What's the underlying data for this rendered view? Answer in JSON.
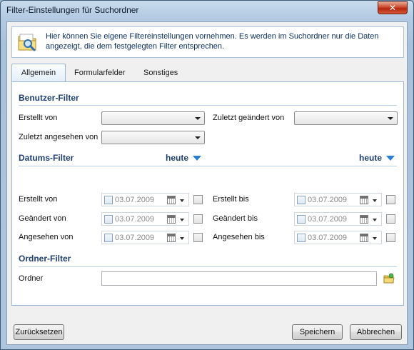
{
  "window": {
    "title": "Filter-Einstellungen für Suchordner"
  },
  "info": {
    "icon": "search-folder-icon",
    "text_line1": "Hier können Sie eigene Filtereinstellungen vornehmen. Es werden im Suchordner nur die Daten",
    "text_line2": "angezeigt, die dem festgelegten Filter entsprechen."
  },
  "tabs": [
    {
      "label": "Allgemein",
      "active": true
    },
    {
      "label": "Formularfelder",
      "active": false
    },
    {
      "label": "Sonstiges",
      "active": false
    }
  ],
  "benutzer_filter": {
    "title": "Benutzer-Filter",
    "erstellt_von": "Erstellt von",
    "zuletzt_geaendert_von": "Zuletzt geändert von",
    "zuletzt_angesehen_von": "Zuletzt angesehen von"
  },
  "datums_filter": {
    "title": "Datums-Filter",
    "heute_left": "heute",
    "heute_right": "heute",
    "rows": [
      {
        "left_label": "Erstellt von",
        "left_date": "03.07.2009",
        "right_label": "Erstellt bis",
        "right_date": "03.07.2009"
      },
      {
        "left_label": "Geändert von",
        "left_date": "03.07.2009",
        "right_label": "Geändert bis",
        "right_date": "03.07.2009"
      },
      {
        "left_label": "Angesehen von",
        "left_date": "03.07.2009",
        "right_label": "Angesehen bis",
        "right_date": "03.07.2009"
      }
    ]
  },
  "ordner_filter": {
    "title": "Ordner-Filter",
    "ordner_label": "Ordner",
    "ordner_value": ""
  },
  "buttons": {
    "reset": "Zurücksetzen",
    "save": "Speichern",
    "cancel": "Abbrechen"
  },
  "colors": {
    "section_title": "#1f3f73",
    "accent": "#2b7fd0",
    "close_button": "#c23a1c"
  }
}
